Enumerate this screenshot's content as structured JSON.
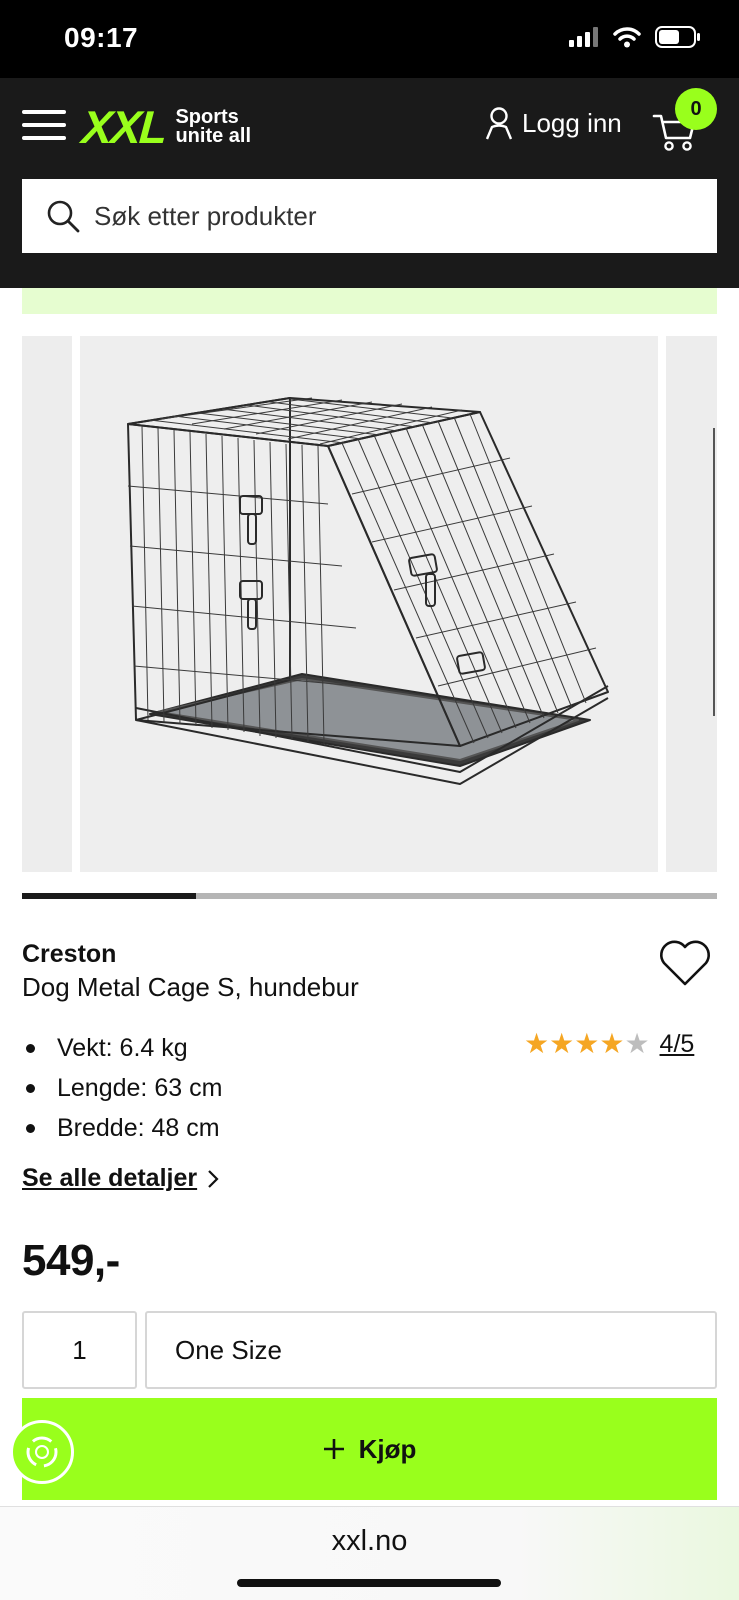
{
  "status_bar": {
    "time": "09:17"
  },
  "header": {
    "logo_brand": "XXL",
    "logo_tagline_1": "Sports",
    "logo_tagline_2": "unite all",
    "login_label": "Logg inn",
    "cart_count": "0"
  },
  "search": {
    "placeholder": "Søk etter produkter"
  },
  "gallery": {
    "image_alt": "Dog Metal Cage S, hundebur",
    "progress": 0.25
  },
  "product": {
    "brand": "Creston",
    "name": "Dog Metal Cage S, hundebur",
    "specs": [
      "Vekt: 6.4 kg",
      "Lengde: 63 cm",
      "Bredde: 48 cm"
    ],
    "rating": {
      "value": 4,
      "max": 5,
      "label": "4/5"
    },
    "details_link": "Se alle detaljer",
    "price": "549,-",
    "quantity": "1",
    "size": "One Size",
    "buy_label": "Kjøp"
  },
  "browser": {
    "url": "xxl.no"
  },
  "colors": {
    "accent": "#99ff1c",
    "header_bg": "#1a1a1a",
    "star": "#f5a623",
    "star_empty": "#bdbdbd"
  }
}
